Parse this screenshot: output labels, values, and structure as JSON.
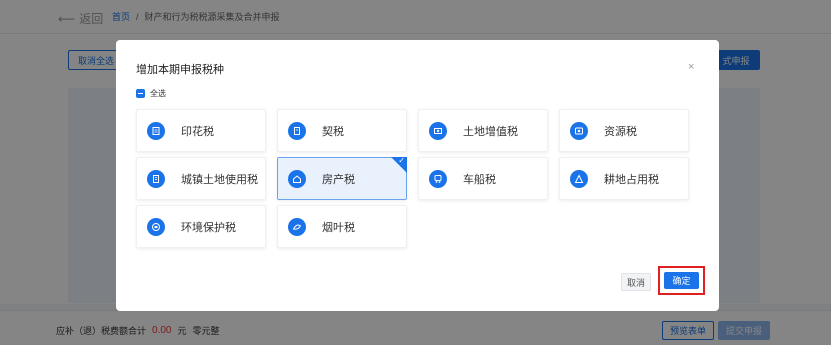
{
  "background": {
    "back_label": "返回",
    "breadcrumb_home": "首页",
    "breadcrumb_sep": "/",
    "breadcrumb_current": "财产和行为税税源采集及合并申报",
    "cancel_all_label": "取消全选",
    "right_button_label": "式申报",
    "footer_label": "应补（退）税费额合计",
    "footer_amount": "0.00",
    "footer_unit": "元",
    "footer_note": "零元整",
    "footer_btn1": "预览表单",
    "footer_btn2": "提交申报"
  },
  "modal": {
    "title": "增加本期申报税种",
    "close": "×",
    "select_all_label": "全选",
    "taxes": [
      {
        "label": "印花税",
        "icon": "stamp-doc-icon",
        "selected": false
      },
      {
        "label": "契税",
        "icon": "contract-doc-icon",
        "selected": false
      },
      {
        "label": "土地增值税",
        "icon": "land-value-icon",
        "selected": false
      },
      {
        "label": "资源税",
        "icon": "resource-icon",
        "selected": false
      },
      {
        "label": "城镇土地使用税",
        "icon": "building-icon",
        "selected": false
      },
      {
        "label": "房产税",
        "icon": "house-icon",
        "selected": true
      },
      {
        "label": "车船税",
        "icon": "vehicle-icon",
        "selected": false
      },
      {
        "label": "耕地占用税",
        "icon": "farmland-icon",
        "selected": false
      },
      {
        "label": "环境保护税",
        "icon": "environment-icon",
        "selected": false
      },
      {
        "label": "烟叶税",
        "icon": "tobacco-leaf-icon",
        "selected": false
      }
    ],
    "cancel_label": "取消",
    "ok_label": "确定"
  },
  "colors": {
    "accent": "#1a73e8",
    "highlight": "#e02020"
  }
}
